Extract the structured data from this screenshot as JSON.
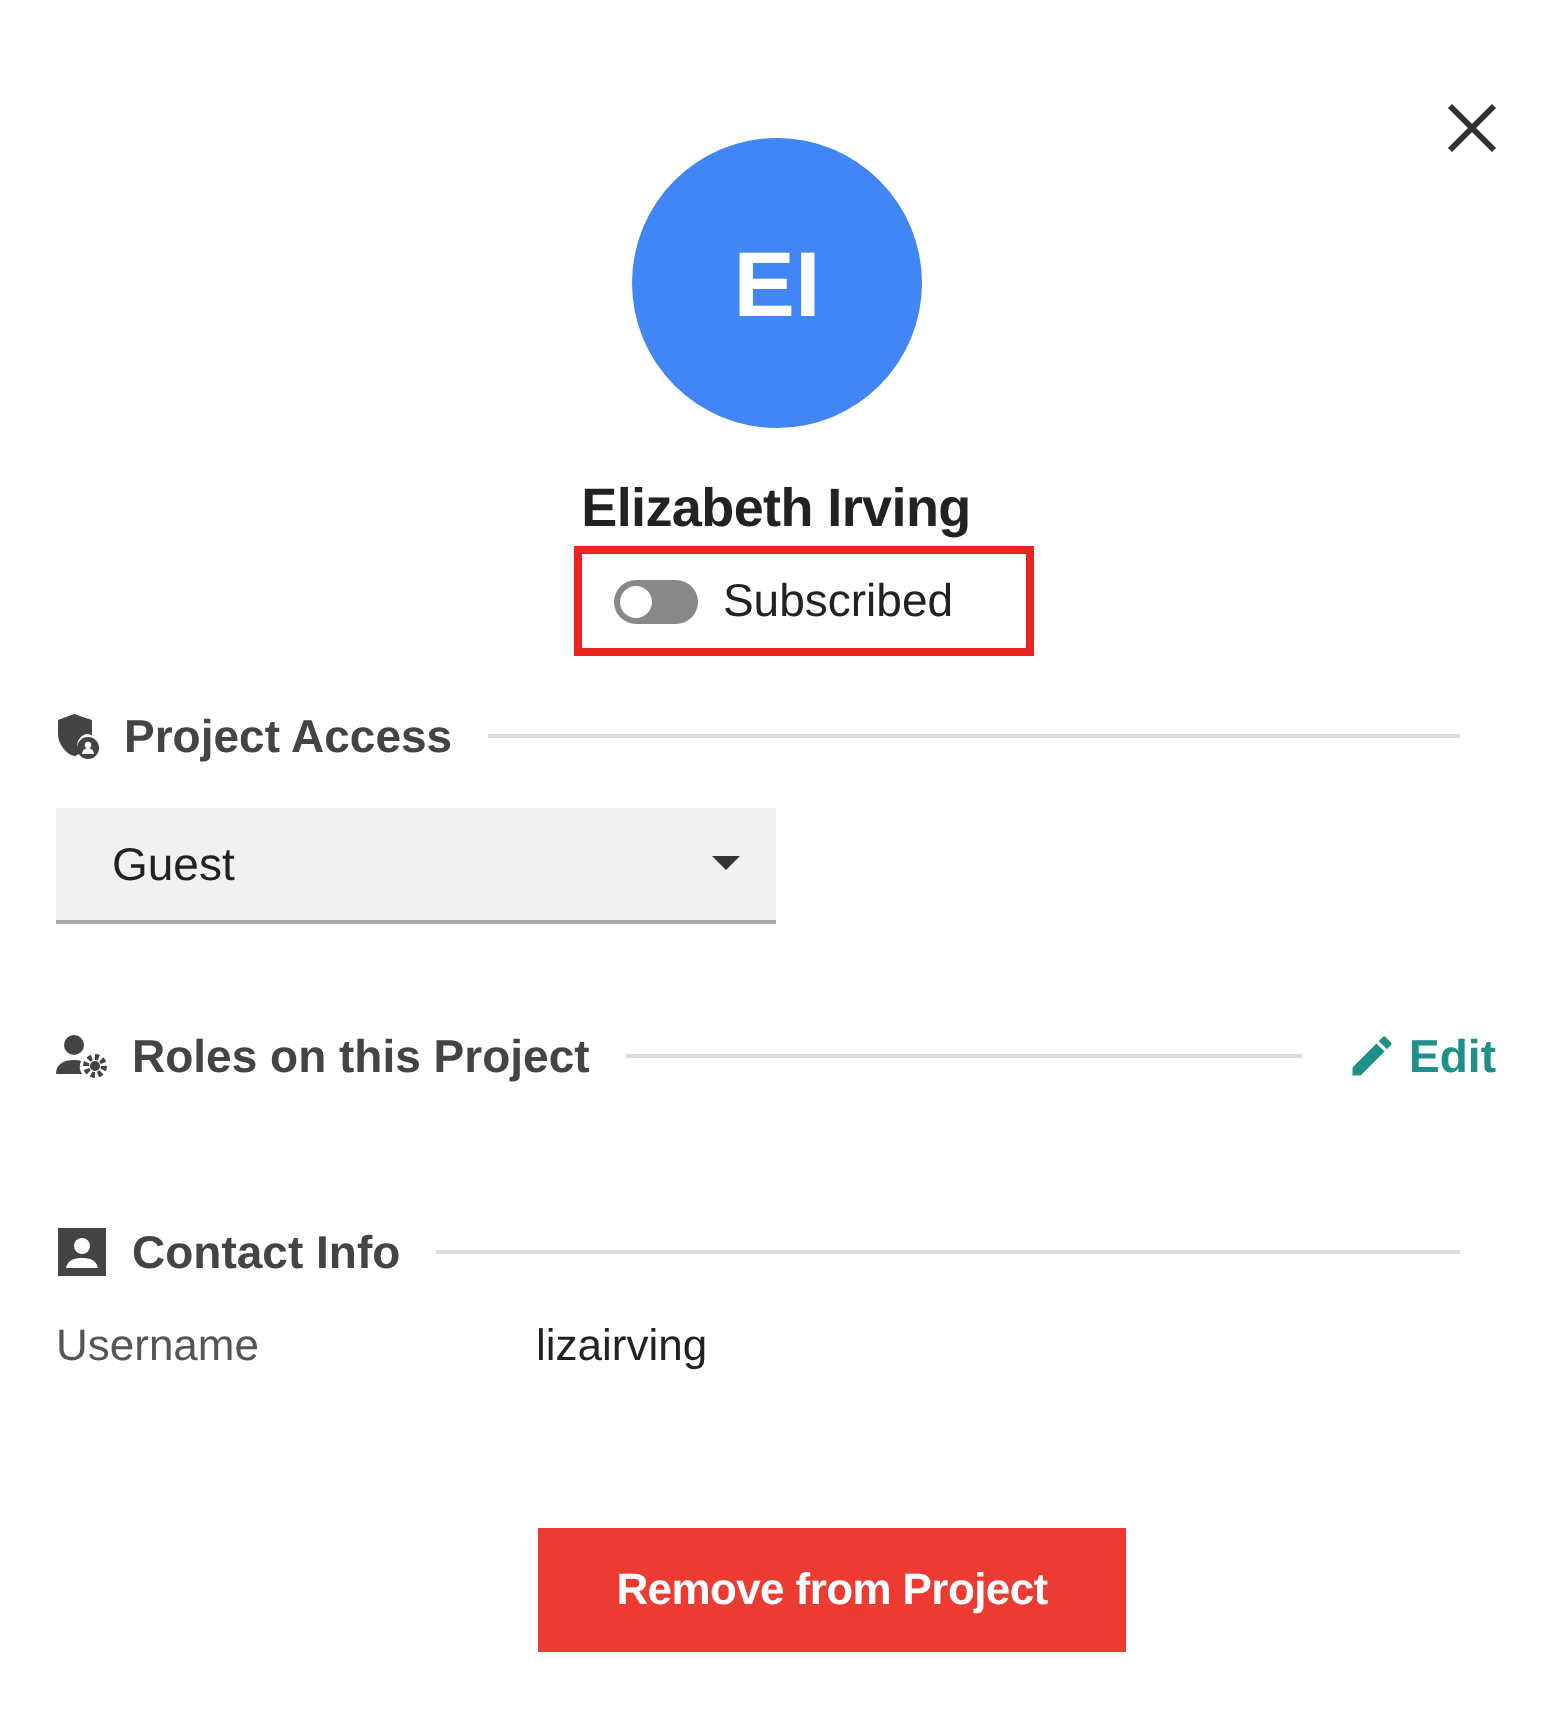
{
  "avatar": {
    "initials": "EI"
  },
  "name": "Elizabeth Irving",
  "subscription": {
    "label": "Subscribed",
    "on": false,
    "highlighted": true
  },
  "project_access": {
    "title": "Project Access",
    "select": {
      "value": "Guest"
    }
  },
  "roles": {
    "title": "Roles on this Project",
    "action": "Edit"
  },
  "contact_info": {
    "title": "Contact Info",
    "fields": [
      {
        "label": "Username",
        "value": "lizairving"
      }
    ]
  },
  "remove_button": "Remove from Project"
}
